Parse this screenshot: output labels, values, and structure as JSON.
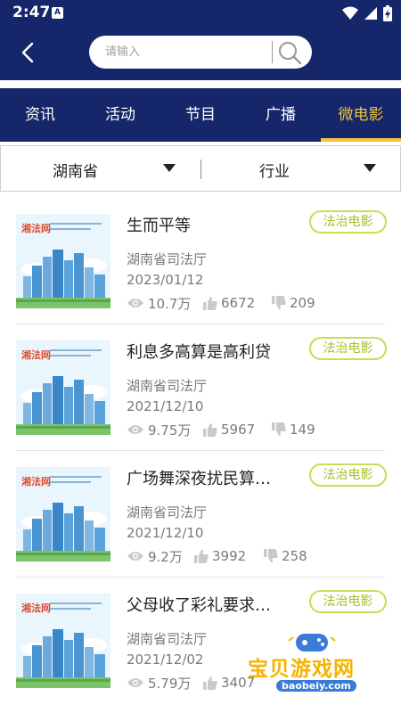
{
  "status_bar": {
    "time": "2:47",
    "notification_icon": "A"
  },
  "header": {
    "search_placeholder": "请输入",
    "back_icon": "chevron-left-icon",
    "search_icon": "search-icon"
  },
  "tabs": [
    {
      "label": "资讯",
      "active": false
    },
    {
      "label": "活动",
      "active": false
    },
    {
      "label": "节目",
      "active": false
    },
    {
      "label": "广播",
      "active": false
    },
    {
      "label": "微电影",
      "active": true
    }
  ],
  "filters": {
    "region": "湖南省",
    "industry": "行业"
  },
  "items": [
    {
      "title": "生而平等",
      "tag": "法治电影",
      "source": "湖南省司法厅",
      "date": "2023/01/12",
      "views": "10.7万",
      "likes": "6672",
      "dislikes": "209"
    },
    {
      "title": "利息多高算是高利贷",
      "tag": "法治电影",
      "source": "湖南省司法厅",
      "date": "2021/12/10",
      "views": "9.75万",
      "likes": "5967",
      "dislikes": "149"
    },
    {
      "title": "广场舞深夜扰民算…",
      "tag": "法治电影",
      "source": "湖南省司法厅",
      "date": "2021/12/10",
      "views": "9.2万",
      "likes": "3992",
      "dislikes": "258"
    },
    {
      "title": "父母收了彩礼要求…",
      "tag": "法治电影",
      "source": "湖南省司法厅",
      "date": "2021/12/02",
      "views": "5.79万",
      "likes": "3407",
      "dislikes": ""
    }
  ],
  "thumbnail": {
    "logo_text": "湘法网"
  },
  "watermark": {
    "text": "宝贝游戏网",
    "url": "baobeiy.com"
  },
  "colors": {
    "primary": "#15266a",
    "accent": "#f1c33c",
    "tag": "#c9dd53"
  }
}
